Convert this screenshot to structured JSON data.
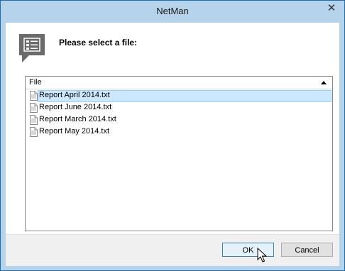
{
  "window": {
    "title": "NetMan",
    "close_glyph": "✕"
  },
  "header": {
    "prompt": "Please select a file:",
    "icon": "list-dialog-icon"
  },
  "listview": {
    "column_header": "File",
    "sort": "ascending",
    "selected_index": 0,
    "items": [
      {
        "label": "Report April 2014.txt",
        "icon": "text-file-icon"
      },
      {
        "label": "Report June 2014.txt",
        "icon": "text-file-icon"
      },
      {
        "label": "Report March 2014.txt",
        "icon": "text-file-icon"
      },
      {
        "label": "Report May 2014.txt",
        "icon": "text-file-icon"
      }
    ]
  },
  "buttons": {
    "ok": "OK",
    "cancel": "Cancel"
  },
  "colors": {
    "titlebar": "#b5d3ea",
    "selection": "#cce8ff",
    "selection_border": "#99d1ff",
    "ok_border": "#3c7fb1",
    "footer": "#f0f0f0"
  }
}
